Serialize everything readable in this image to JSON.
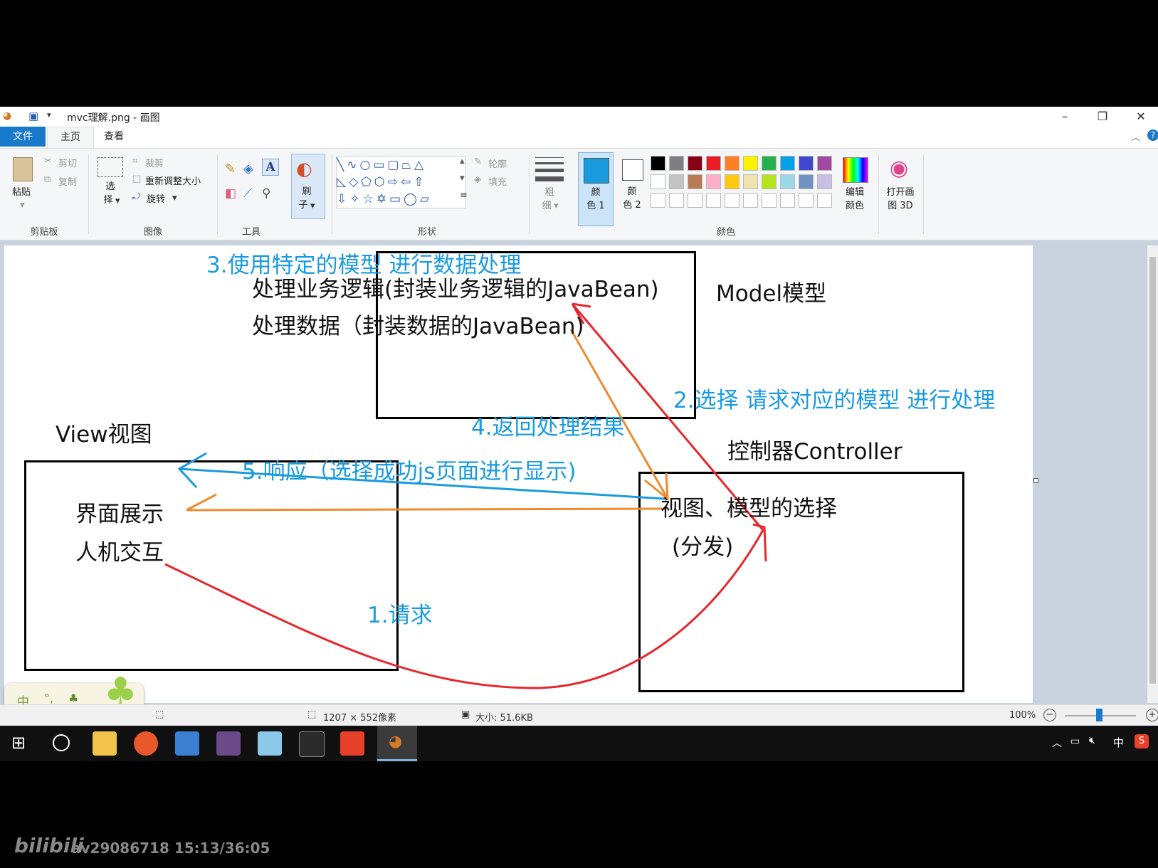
{
  "window": {
    "title": "mvc理解.png - 画图"
  },
  "tabs": [
    "文件",
    "主页",
    "查看"
  ],
  "ribbon": {
    "clipboard": {
      "paste": "粘贴",
      "cut": "剪切",
      "copy": "复制",
      "group": "剪贴板"
    },
    "image": {
      "select_top": "选",
      "select_bottom": "择",
      "crop": "裁剪",
      "resize": "重新调整大小",
      "rotate": "旋转",
      "group": "图像"
    },
    "tools": {
      "group": "工具"
    },
    "brush": {
      "top": "刷",
      "bottom": "子"
    },
    "shapes": {
      "outline": "轮廓",
      "fill": "填充",
      "group": "形状"
    },
    "size": {
      "top": "粗",
      "bottom": "细"
    },
    "color1": {
      "top": "颜",
      "bottom": "色 1"
    },
    "color2": {
      "top": "颜",
      "bottom": "色 2"
    },
    "edit_colors": {
      "top": "编辑",
      "bottom": "颜色"
    },
    "paint3d": {
      "top": "打开画",
      "bottom": "图 3D"
    },
    "colors_group": "颜色",
    "palette_row1": [
      "#000000",
      "#7f7f7f",
      "#880015",
      "#ed1c24",
      "#ff7f27",
      "#fff200",
      "#22b14c",
      "#00a2e8",
      "#3f48cc",
      "#a349a4"
    ],
    "palette_row2": [
      "#ffffff",
      "#c3c3c3",
      "#b97a57",
      "#ffaec9",
      "#ffc90e",
      "#efe4b0",
      "#b5e61d",
      "#99d9ea",
      "#7092be",
      "#c8bfe7"
    ],
    "color1_value": "#1a9be0",
    "color2_value": "#ffffff"
  },
  "diagram": {
    "model_line1": "处理业务逻辑(封装业务逻辑的JavaBean)",
    "model_line2": "处理数据（封装数据的JavaBean)",
    "model_title": "Model模型",
    "view_title": "View视图",
    "view_line1": "界面展示",
    "view_line2": "人机交互",
    "controller_title": "控制器Controller",
    "controller_line1": "视图、模型的选择",
    "controller_line2": "(分发)",
    "step1": "1.请求",
    "step2": "2.选择 请求对应的模型 进行处理",
    "step3": "3.使用特定的模型 进行数据处理",
    "step4": "4.返回处理结果",
    "step5": "5.响应（选择成功js页面进行显示)"
  },
  "status": {
    "dimensions": "1207 × 552像素",
    "size": "大小: 51.6KB",
    "zoom": "100%",
    "ime": "中"
  },
  "watermark": {
    "logo": "bilibili",
    "info": "av29086718 15:13/36:05"
  },
  "tray": {
    "ime": "中"
  }
}
